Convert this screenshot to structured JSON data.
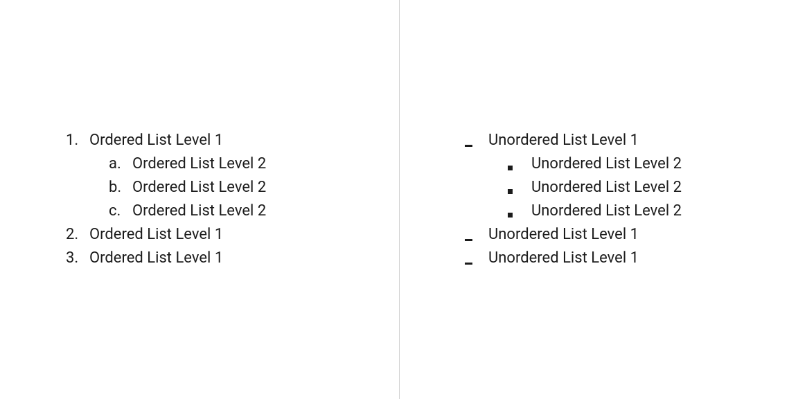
{
  "ordered": {
    "level1": [
      {
        "marker": "1.",
        "label": "Ordered List Level 1",
        "children": [
          {
            "marker": "a.",
            "label": "Ordered List Level 2"
          },
          {
            "marker": "b.",
            "label": "Ordered List Level 2"
          },
          {
            "marker": "c.",
            "label": "Ordered List Level 2"
          }
        ]
      },
      {
        "marker": "2.",
        "label": "Ordered List Level 1",
        "children": []
      },
      {
        "marker": "3.",
        "label": "Ordered List Level 1",
        "children": []
      }
    ]
  },
  "unordered": {
    "level1": [
      {
        "bullet": "dash",
        "label": "Unordered List Level 1",
        "children": [
          {
            "bullet": "square",
            "label": "Unordered List Level 2"
          },
          {
            "bullet": "square",
            "label": "Unordered List Level 2"
          },
          {
            "bullet": "square",
            "label": "Unordered List Level 2"
          }
        ]
      },
      {
        "bullet": "dash",
        "label": "Unordered List Level 1",
        "children": []
      },
      {
        "bullet": "dash",
        "label": "Unordered List Level 1",
        "children": []
      }
    ]
  }
}
